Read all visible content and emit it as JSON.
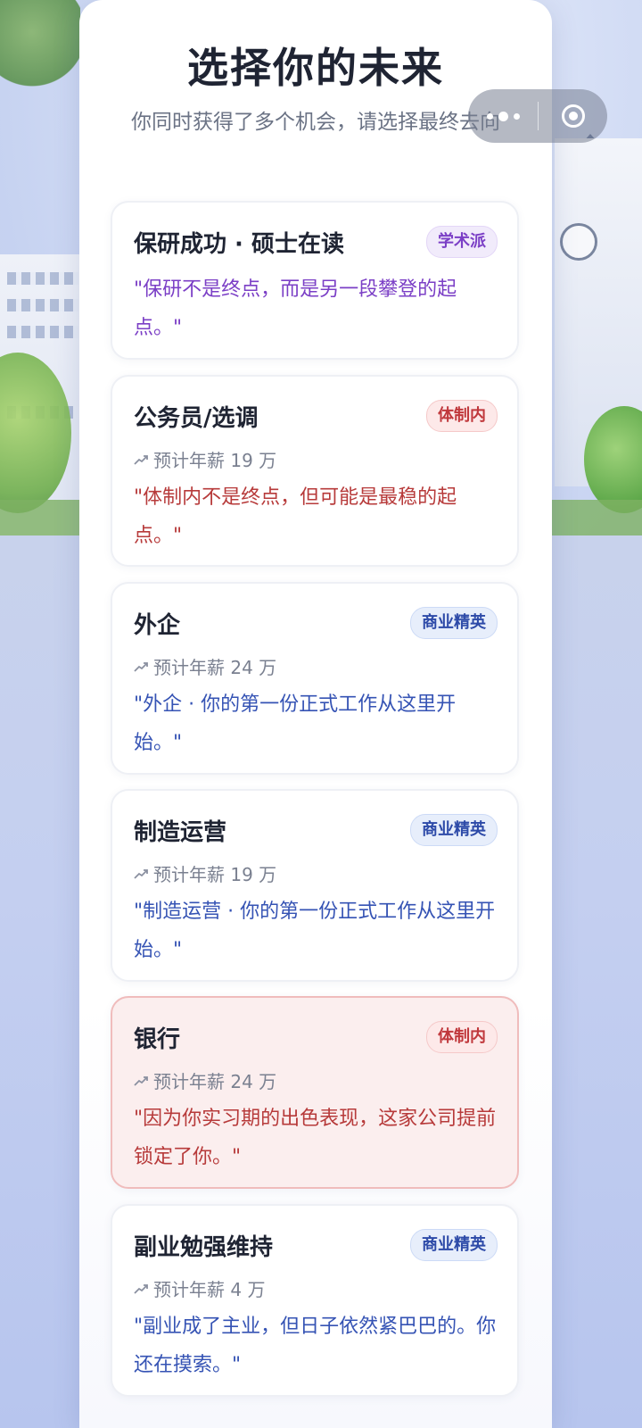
{
  "page": {
    "title": "选择你的未来",
    "subtitle": "你同时获得了多个机会，请选择最终去向"
  },
  "capsule": {
    "more_icon": "more-dots-icon",
    "close_icon": "target-close-icon"
  },
  "colors": {
    "academic": "#7b3fc6",
    "system": "#c0383c",
    "business": "#2d4aa8",
    "selected_bg": "#fbeeee"
  },
  "cards": [
    {
      "title": "保研成功 · 硕士在读",
      "badge": "学术派",
      "salary": "",
      "quote": "\"保研不是终点，而是另一段攀登的起点。\"",
      "selected": false
    },
    {
      "title": "公务员/选调",
      "badge": "体制内",
      "salary": "预计年薪 19 万",
      "quote": "\"体制内不是终点，但可能是最稳的起点。\"",
      "selected": false
    },
    {
      "title": "外企",
      "badge": "商业精英",
      "salary": "预计年薪 24 万",
      "quote": "\"外企 · 你的第一份正式工作从这里开始。\"",
      "selected": false
    },
    {
      "title": "制造运营",
      "badge": "商业精英",
      "salary": "预计年薪 19 万",
      "quote": "\"制造运营 · 你的第一份正式工作从这里开始。\"",
      "selected": false
    },
    {
      "title": "银行",
      "badge": "体制内",
      "salary": "预计年薪 24 万",
      "quote": "\"因为你实习期的出色表现，这家公司提前锁定了你。\"",
      "selected": true
    },
    {
      "title": "副业勉强维持",
      "badge": "商业精英",
      "salary": "预计年薪 4 万",
      "quote": "\"副业成了主业，但日子依然紧巴巴的。你还在摸索。\"",
      "selected": false
    }
  ]
}
